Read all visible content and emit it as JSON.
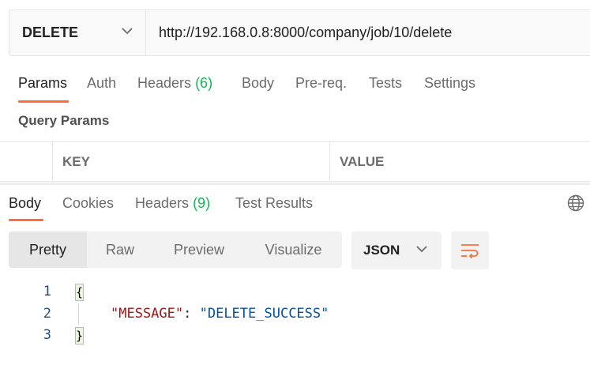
{
  "request": {
    "method": "DELETE",
    "url": "http://192.168.0.8:8000/company/job/10/delete"
  },
  "request_tabs": [
    {
      "label": "Params",
      "active": true
    },
    {
      "label": "Auth"
    },
    {
      "label": "Headers",
      "count": "(6)"
    },
    {
      "label": "Body"
    },
    {
      "label": "Pre-req."
    },
    {
      "label": "Tests"
    },
    {
      "label": "Settings"
    }
  ],
  "query_params": {
    "title": "Query Params",
    "columns": [
      "KEY",
      "VALUE"
    ]
  },
  "response_tabs": [
    {
      "label": "Body",
      "active": true
    },
    {
      "label": "Cookies"
    },
    {
      "label": "Headers",
      "count": "(9)"
    },
    {
      "label": "Test Results"
    }
  ],
  "view_modes": [
    "Pretty",
    "Raw",
    "Preview",
    "Visualize"
  ],
  "active_view_mode": "Pretty",
  "format": "JSON",
  "response_body": {
    "lines": [
      {
        "number": "1",
        "text": "{"
      },
      {
        "number": "2",
        "key": "\"MESSAGE\"",
        "sep": ": ",
        "value": "\"DELETE_SUCCESS\""
      },
      {
        "number": "3",
        "text": "}"
      }
    ]
  },
  "icons": {
    "method_chevron": "chevron-down-icon",
    "format_chevron": "chevron-down-icon",
    "globe": "globe-icon",
    "wrap": "wrap-lines-icon"
  },
  "colors": {
    "accent": "#ff6c37",
    "count": "#0cbb52",
    "json_key": "#a31515",
    "json_string": "#0451a5"
  }
}
